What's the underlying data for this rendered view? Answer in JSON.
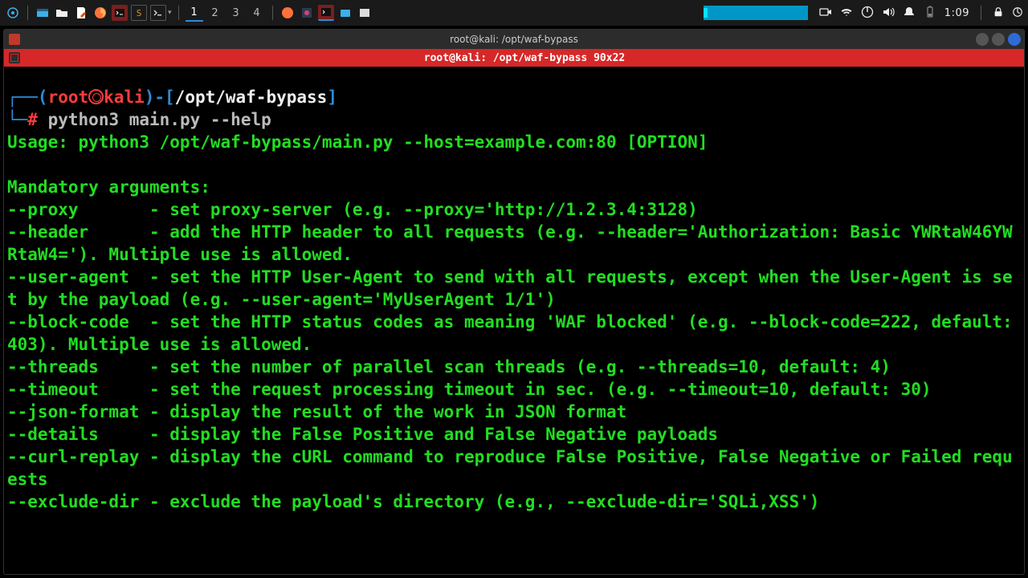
{
  "panel": {
    "workspaces": [
      "1",
      "2",
      "3",
      "4"
    ],
    "active_workspace": 0,
    "clock": "1:09"
  },
  "window": {
    "title": "root@kali: /opt/waf-bypass",
    "tab_label": "root@kali: /opt/waf-bypass 90x22"
  },
  "prompt": {
    "l1_open": "┌──(",
    "user": "root",
    "host": "kali",
    "l1_mid": ")-[",
    "path": "/opt/waf-bypass",
    "l1_close": "]",
    "l2_open": "└─",
    "sym": "#",
    "command": "python3 main.py --help"
  },
  "output": "Usage: python3 /opt/waf-bypass/main.py --host=example.com:80 [OPTION]\n\nMandatory arguments:\n--proxy       - set proxy-server (e.g. --proxy='http://1.2.3.4:3128)\n--header      - add the HTTP header to all requests (e.g. --header='Authorization: Basic YWRtaW46YWRtaW4='). Multiple use is allowed.\n--user-agent  - set the HTTP User-Agent to send with all requests, except when the User-Agent is set by the payload (e.g. --user-agent='MyUserAgent 1/1')\n--block-code  - set the HTTP status codes as meaning 'WAF blocked' (e.g. --block-code=222, default: 403). Multiple use is allowed.\n--threads     - set the number of parallel scan threads (e.g. --threads=10, default: 4)\n--timeout     - set the request processing timeout in sec. (e.g. --timeout=10, default: 30)\n--json-format - display the result of the work in JSON format\n--details     - display the False Positive and False Negative payloads\n--curl-replay - display the cURL command to reproduce False Positive, False Negative or Failed requests\n--exclude-dir - exclude the payload's directory (e.g., --exclude-dir='SQLi,XSS')"
}
